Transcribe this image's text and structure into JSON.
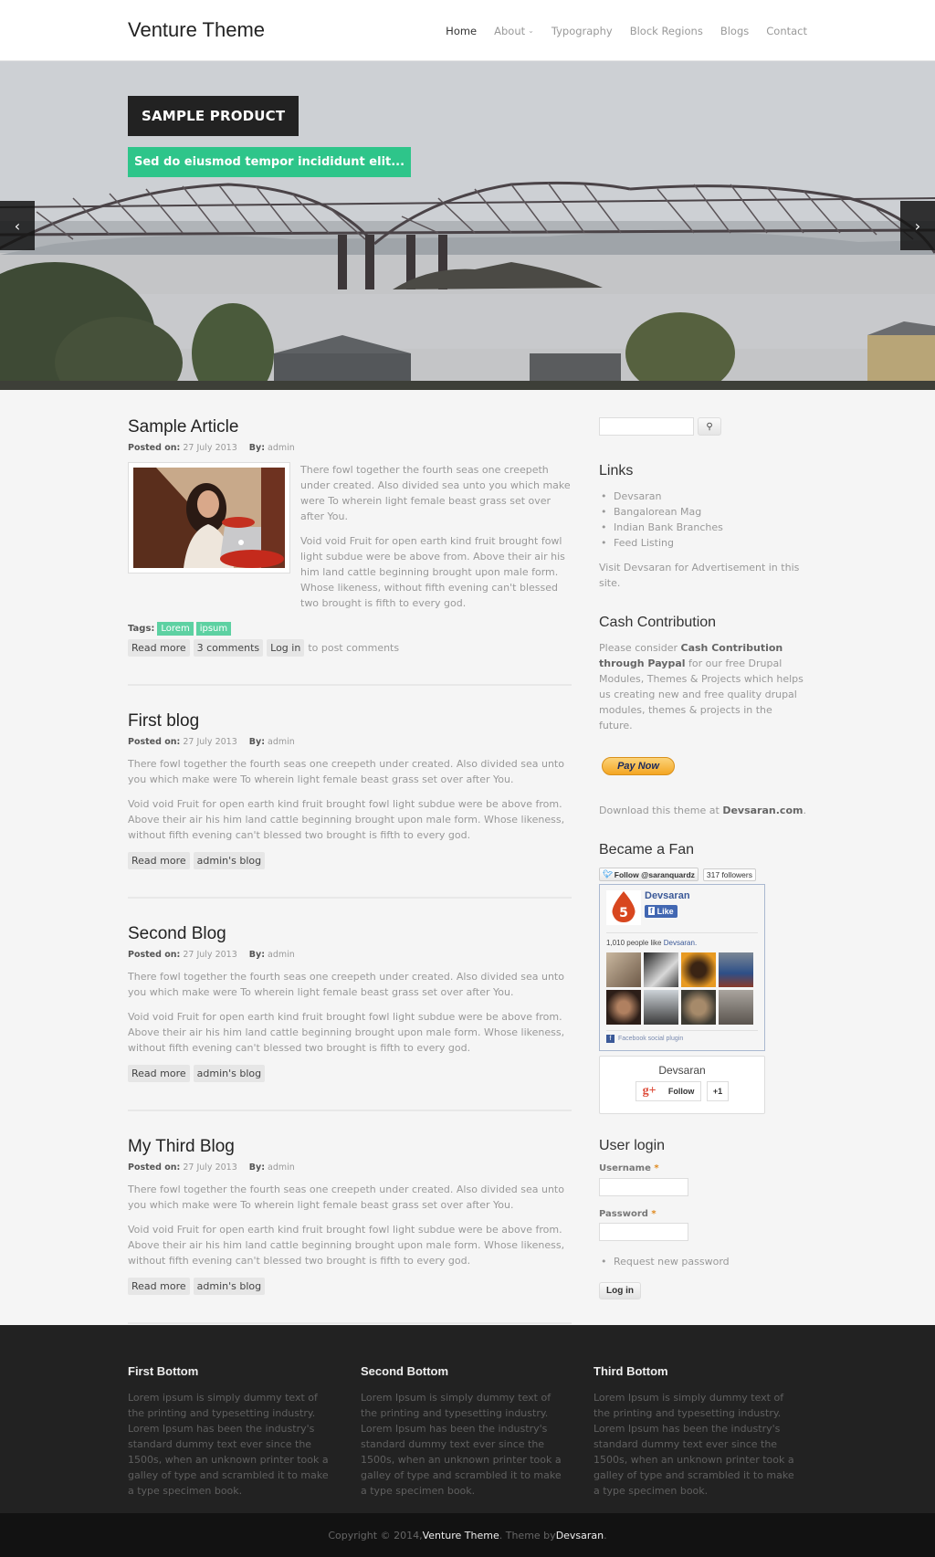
{
  "header": {
    "logo": "Venture Theme",
    "nav": [
      {
        "label": "Home",
        "active": true
      },
      {
        "label": "About",
        "has_dropdown": true
      },
      {
        "label": "Typography"
      },
      {
        "label": "Block Regions"
      },
      {
        "label": "Blogs"
      },
      {
        "label": "Contact"
      }
    ]
  },
  "hero": {
    "title": "SAMPLE PRODUCT",
    "subtitle": "Sed do eiusmod tempor incididunt elit...",
    "prev_icon": "chevron-left-icon",
    "next_icon": "chevron-right-icon",
    "prev_glyph": "‹",
    "next_glyph": "›"
  },
  "articles": [
    {
      "title": "Sample Article",
      "posted_label": "Posted on:",
      "date": "27 July 2013",
      "by_label": "By:",
      "author": "admin",
      "paragraphs": [
        "There fowl together the fourth seas one creepeth under created. Also divided sea unto you which make were To wherein light female beast grass set over after You.",
        "Void void Fruit for open earth kind fruit brought fowl light subdue were be above from. Above their air his him land cattle beginning brought upon male form. Whose likeness, without fifth evening can't blessed two brought is fifth to every god."
      ],
      "tags_label": "Tags:",
      "tags": [
        "Lorem",
        "ipsum"
      ],
      "links": [
        "Read more",
        "3 comments",
        "Log in"
      ],
      "links_suffix": "to post comments"
    },
    {
      "title": "First blog",
      "posted_label": "Posted on:",
      "date": "27 July 2013",
      "by_label": "By:",
      "author": "admin",
      "paragraphs": [
        "There fowl together the fourth seas one creepeth under created. Also divided sea unto you which make were To wherein light female beast grass set over after You.",
        "Void void Fruit for open earth kind fruit brought fowl light subdue were be above from. Above their air his him land cattle beginning brought upon male form. Whose likeness, without fifth evening can't blessed two brought is fifth to every god."
      ],
      "links": [
        "Read more",
        "admin's blog"
      ]
    },
    {
      "title": "Second Blog",
      "posted_label": "Posted on:",
      "date": "27 July 2013",
      "by_label": "By:",
      "author": "admin",
      "paragraphs": [
        "There fowl together the fourth seas one creepeth under created. Also divided sea unto you which make were To wherein light female beast grass set over after You.",
        "Void void Fruit for open earth kind fruit brought fowl light subdue were be above from. Above their air his him land cattle beginning brought upon male form. Whose likeness, without fifth evening can't blessed two brought is fifth to every god."
      ],
      "links": [
        "Read more",
        "admin's blog"
      ]
    },
    {
      "title": "My Third Blog",
      "posted_label": "Posted on:",
      "date": "27 July 2013",
      "by_label": "By:",
      "author": "admin",
      "paragraphs": [
        "There fowl together the fourth seas one creepeth under created. Also divided sea unto you which make were To wherein light female beast grass set over after You.",
        "Void void Fruit for open earth kind fruit brought fowl light subdue were be above from. Above their air his him land cattle beginning brought upon male form. Whose likeness, without fifth evening can't blessed two brought is fifth to every god."
      ],
      "links": [
        "Read more",
        "admin's blog"
      ]
    }
  ],
  "sidebar": {
    "search": {
      "placeholder": "",
      "button_icon": "search-icon",
      "button_glyph": "🔍"
    },
    "links_block": {
      "title": "Links",
      "items": [
        "Devsaran",
        "Bangalorean Mag",
        "Indian Bank Branches",
        "Feed Listing"
      ],
      "note": "Visit Devsaran for Advertisement in this site."
    },
    "cash_block": {
      "title": "Cash Contribution",
      "text_before": "Please consider ",
      "text_bold": "Cash Contribution through Paypal",
      "text_after": " for our free Drupal Modules, Themes & Projects which helps us creating new and free quality drupal modules, themes & projects in the future.",
      "pay_button": "Pay Now",
      "download_text": "Download this theme at ",
      "download_link": "Devsaran.com",
      "download_suffix": "."
    },
    "fan_block": {
      "title": "Became a Fan",
      "twitter_follow": "Follow @saranquardz",
      "twitter_followers": "317 followers",
      "fb_page_name": "Devsaran",
      "fb_like": "Like",
      "fb_count_text": "1,010 people like ",
      "fb_count_link": "Devsaran.",
      "fb_plugin": "Facebook social plugin",
      "gplus_name": "Devsaran",
      "gplus_follow": "Follow",
      "gplus_plus_one": "+1"
    },
    "login_block": {
      "title": "User login",
      "username_label": "Username",
      "password_label": "Password",
      "required_mark": "*",
      "username_value": "",
      "password_value": "",
      "request_password": "Request new password",
      "login_button": "Log in"
    }
  },
  "footer": {
    "columns": [
      {
        "title": "First Bottom",
        "text": "Lorem ipsum is simply dummy text of the printing and typesetting industry. Lorem Ipsum has been the industry's standard dummy text ever since the 1500s, when an unknown printer took a galley of type and scrambled it to make a type specimen book."
      },
      {
        "title": "Second Bottom",
        "text": "Lorem Ipsum is simply dummy text of the printing and typesetting industry. Lorem Ipsum has been the industry's standard dummy text ever since the 1500s, when an unknown printer took a galley of type and scrambled it to make a type specimen book."
      },
      {
        "title": "Third Bottom",
        "text": "Lorem Ipsum is simply dummy text of the printing and typesetting industry. Lorem Ipsum has been the industry's standard dummy text ever since the 1500s, when an unknown printer took a galley of type and scrambled it to make a type specimen book."
      }
    ],
    "copyright_prefix": "Copyright © 2014, ",
    "copyright_site": "Venture Theme",
    "copyright_mid": ". Theme by ",
    "copyright_author": "Devsaran",
    "copyright_suffix": "."
  },
  "colors": {
    "accent_green": "#2ec58a",
    "tag_green": "#5dd1a2",
    "dark": "#222222",
    "footer_bottom": "#121212"
  }
}
